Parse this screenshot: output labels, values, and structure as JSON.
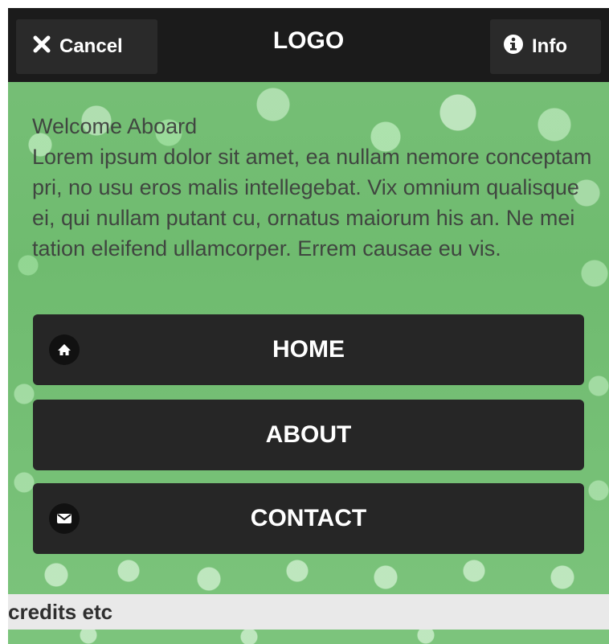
{
  "header": {
    "cancel_label": "Cancel",
    "logo": "LOGO",
    "info_label": "Info"
  },
  "content": {
    "heading": "Welcome Aboard",
    "body": "Lorem ipsum dolor sit amet, ea nullam nemore conceptam pri, no usu eros malis intellegebat. Vix omnium qualisque ei, qui nullam putant cu, ornatus maiorum his an. Ne mei tation eleifend ullamcorper. Errem causae eu vis."
  },
  "nav": {
    "items": [
      {
        "label": "HOME",
        "icon": "home-icon"
      },
      {
        "label": "ABOUT",
        "icon": null
      },
      {
        "label": "CONTACT",
        "icon": "mail-icon"
      }
    ]
  },
  "footer": {
    "text": "credits etc"
  },
  "colors": {
    "header_bg": "#1b1b1b",
    "button_bg": "#262626",
    "background": "#78c078",
    "footer_bg": "#e9e9e9"
  }
}
